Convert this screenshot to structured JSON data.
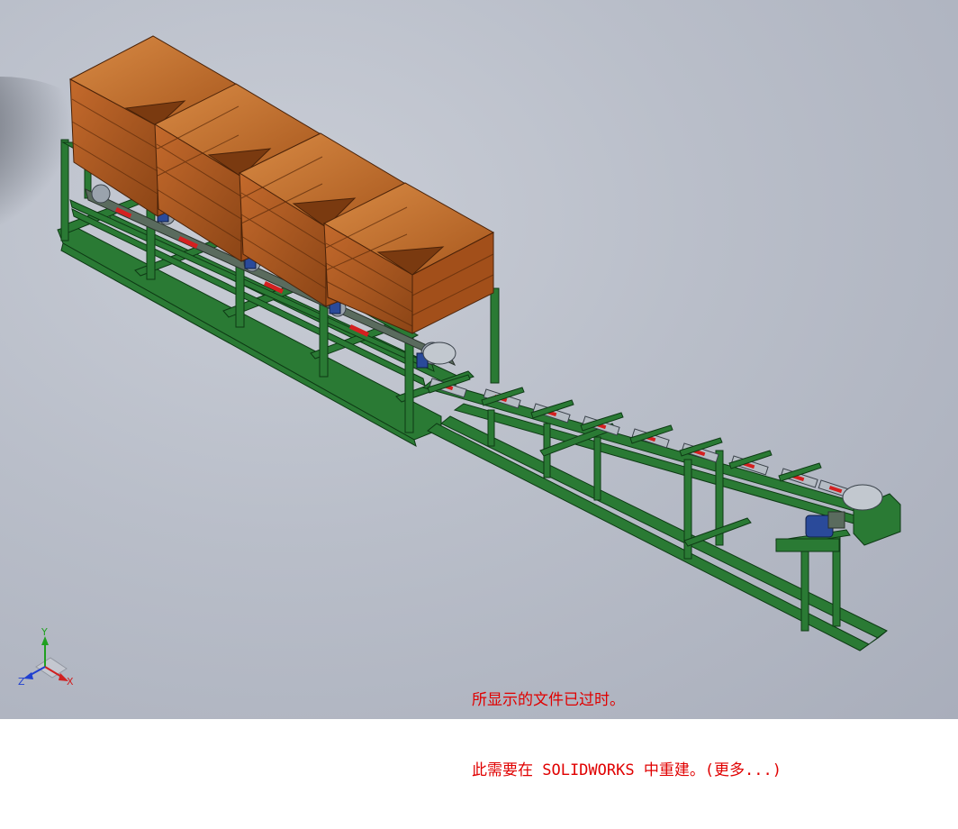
{
  "app": {
    "name": "SOLIDWORKS"
  },
  "message": {
    "line1": "所显示的文件已过时。",
    "line2": "此需要在 SOLIDWORKS 中重建。(更多...)",
    "color": "#e00000"
  },
  "triad": {
    "x_label": "X",
    "y_label": "Y",
    "z_label": "Z",
    "x_color": "#d02020",
    "y_color": "#20a020",
    "z_color": "#2040d0"
  },
  "model": {
    "frame_color": "#1f6b2a",
    "hopper_color": "#b8612a",
    "roller_accent": "#d42020",
    "motor_color": "#2a4a9a",
    "hopper_count": 4
  }
}
